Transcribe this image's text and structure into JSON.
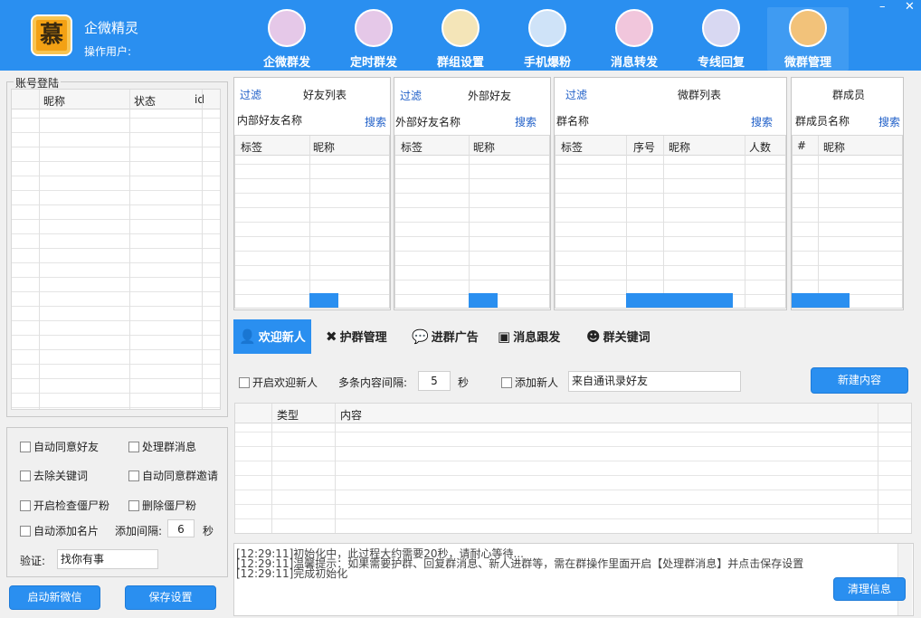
{
  "header": {
    "logo_char": "慕",
    "app_title": "企微精灵",
    "operator_label": "操作用户:",
    "nav": [
      {
        "label": "企微群发",
        "icon": "document-icon"
      },
      {
        "label": "定时群发",
        "icon": "pie-chart-icon"
      },
      {
        "label": "群组设置",
        "icon": "edit-icon"
      },
      {
        "label": "手机爆粉",
        "icon": "phone-icon"
      },
      {
        "label": "消息转发",
        "icon": "safe-icon"
      },
      {
        "label": "专线回复",
        "icon": "bar-chart-icon"
      },
      {
        "label": "微群管理",
        "icon": "shield-icon"
      }
    ],
    "active_nav": "微群管理",
    "minimize": "–",
    "close": "✕"
  },
  "account": {
    "title": "账号登陆",
    "columns": [
      "昵称",
      "状态",
      "id"
    ]
  },
  "options": {
    "auto_accept_friend": "自动同意好友",
    "handle_group_msg": "处理群消息",
    "remove_keywords": "去除关键词",
    "auto_accept_group_invite": "自动同意群邀请",
    "check_zombie": "开启检查僵尸粉",
    "delete_zombie": "删除僵尸粉",
    "auto_add_card": "自动添加名片",
    "add_interval_label": "添加间隔:",
    "add_interval_value": "6",
    "add_interval_unit": "秒",
    "verify_label": "验证:",
    "verify_value": "找你有事"
  },
  "buttons": {
    "start_wechat": "启动新微信",
    "save_settings": "保存设置",
    "new_content": "新建内容",
    "clear_info": "清理信息"
  },
  "friends": {
    "filter": "过滤",
    "title": "好友列表",
    "name_label": "内部好友名称",
    "search": "搜索",
    "columns": [
      "标签",
      "昵称"
    ]
  },
  "external": {
    "filter": "过滤",
    "title": "外部好友",
    "name_label": "外部好友名称",
    "search": "搜索",
    "columns": [
      "标签",
      "昵称"
    ]
  },
  "groups": {
    "filter": "过滤",
    "title": "微群列表",
    "name_label": "群名称",
    "search": "搜索",
    "columns": [
      "标签",
      "序号",
      "昵称",
      "人数"
    ]
  },
  "members": {
    "title": "群成员",
    "name_label": "群成员名称",
    "search": "搜索",
    "columns": [
      "#",
      "昵称"
    ]
  },
  "tabs": [
    {
      "label": "欢迎新人",
      "icon": "user-icon",
      "glyph": "👤"
    },
    {
      "label": "护群管理",
      "icon": "tools-icon",
      "glyph": "✖"
    },
    {
      "label": "进群广告",
      "icon": "chat-icon",
      "glyph": "💬"
    },
    {
      "label": "消息跟发",
      "icon": "message-icon",
      "glyph": "▣"
    },
    {
      "label": "群关键词",
      "icon": "robot-icon",
      "glyph": "☻"
    }
  ],
  "welcome": {
    "enable": "开启欢迎新人",
    "interval_label": "多条内容间隔:",
    "interval_value": "5",
    "interval_unit": "秒",
    "add_new": "添加新人",
    "source_value": "来自通讯录好友",
    "columns": [
      "类型",
      "内容"
    ]
  },
  "logs": [
    "[12:29:11]初始化中，此过程大约需要20秒，请耐心等待...",
    "[12:29:11]温馨提示：如果需要护群、回复群消息、新人进群等，需在群操作里面开启【处理群消息】并点击保存设置",
    "[12:29:11]完成初始化"
  ]
}
